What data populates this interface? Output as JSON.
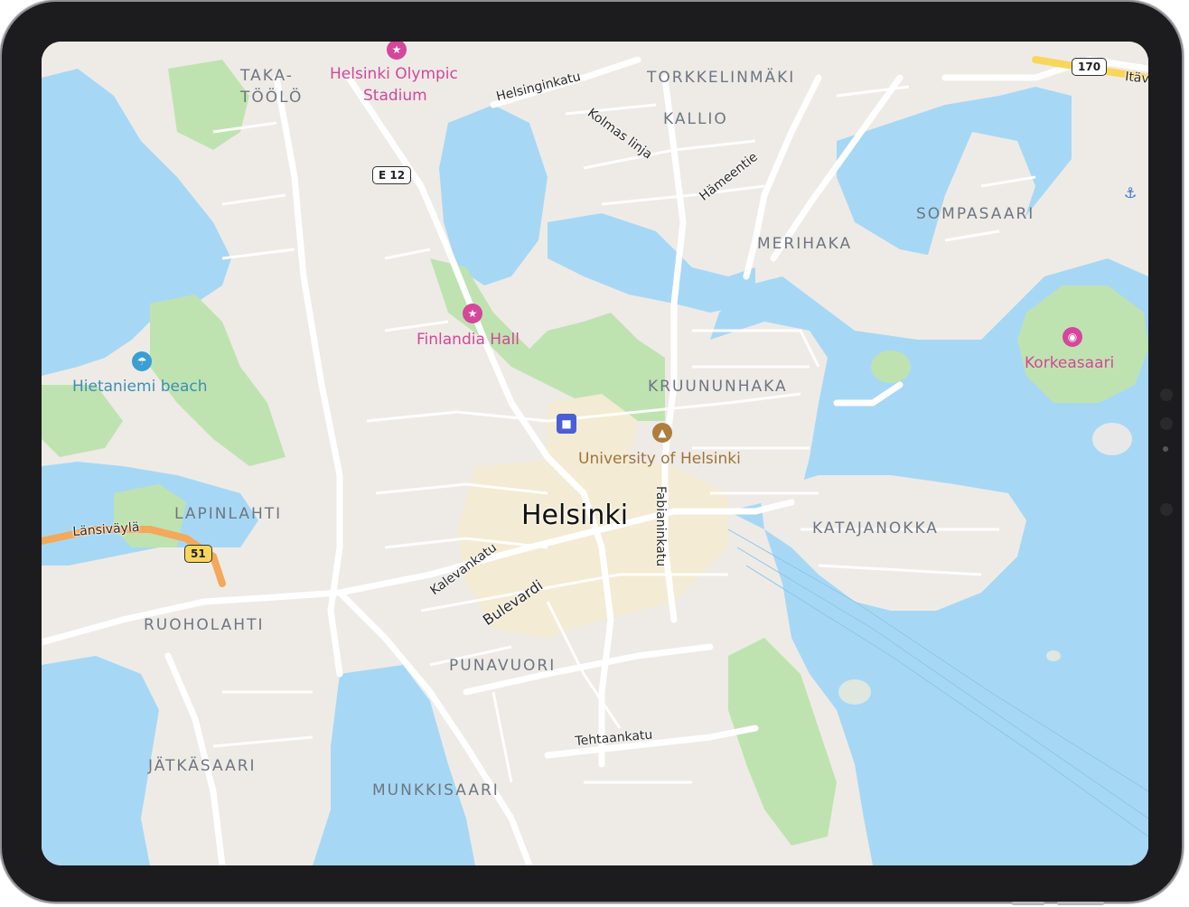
{
  "map": {
    "city": "Helsinki",
    "districts": {
      "taka_toolo_1": "TAKA-",
      "taka_toolo_2": "TÖÖLÖ",
      "torkkelinmaki": "TORKKELINMÄKI",
      "kallio": "KALLIO",
      "sompasaari": "SOMPASAARI",
      "merihaka": "MERIHAKA",
      "kruununhaka": "KRUUNUNHAKA",
      "lapinlahti": "LAPINLAHTI",
      "katajanokka": "KATAJANOKKA",
      "ruoholahti": "RUOHOLAHTI",
      "punavuori": "PUNAVUORI",
      "jatkasaari": "JÄTKÄSAARI",
      "munkkisaari": "MUNKKISAARI"
    },
    "pois": {
      "olympic_1": "Helsinki Olympic",
      "olympic_2": "Stadium",
      "finlandia": "Finlandia Hall",
      "korkeasaari": "Korkeasaari",
      "university": "University of Helsinki",
      "beach": "Hietaniemi beach"
    },
    "streets": {
      "helsinginkatu": "Helsinginkatu",
      "kolmas_linja": "Kolmas linja",
      "hameentie": "Hämeentie",
      "lansivayla": "Länsiväylä",
      "kalevankatu": "Kalevankatu",
      "bulevardi": "Bulevardi",
      "fabianinkatu": "Fabianinkatu",
      "tehtaankatu": "Tehtaankatu",
      "itav": "Itäv"
    },
    "shields": {
      "e12": "E 12",
      "r51": "51",
      "r170": "170"
    },
    "icons": {
      "stadium": "theater-icon",
      "finlandia": "theater-icon",
      "zoo": "camera-icon",
      "university": "graduation-cap-icon",
      "beach": "umbrella-icon",
      "station": "train-icon",
      "boat": "boat-icon"
    },
    "colors": {
      "water": "#a6d8f5",
      "park": "#bfe3b0",
      "land": "#eeebe6",
      "road": "#ffffff",
      "motorway": "#f4a85a"
    }
  }
}
